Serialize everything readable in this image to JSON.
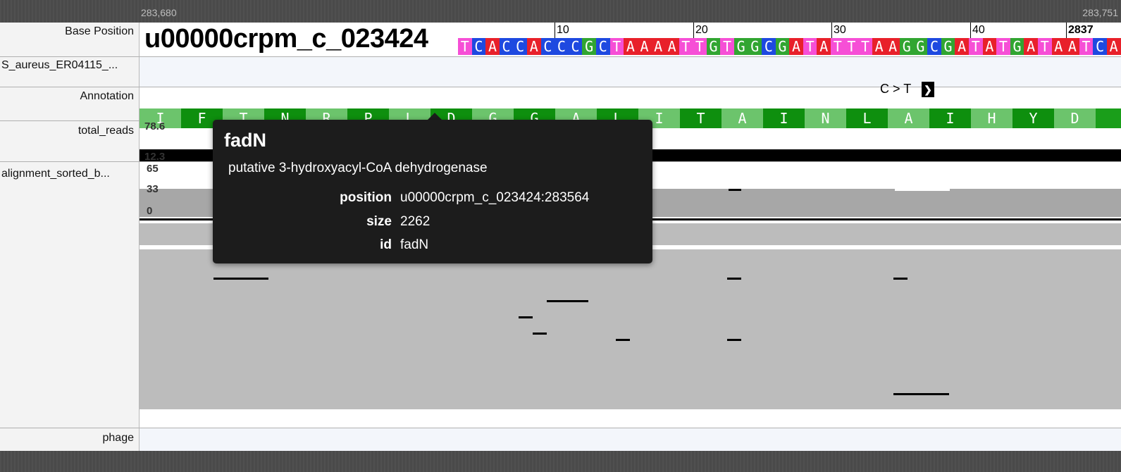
{
  "ruler": {
    "left_coord": "283,680",
    "right_coord": "283,751"
  },
  "labels": {
    "base_position": "Base Position",
    "variant_track": "S_aureus_ER04115_...",
    "annotation": "Annotation",
    "total_reads": "total_reads",
    "alignment": "alignment_sorted_b...",
    "phage": "phage"
  },
  "scaffold_name": "u00000crpm_c_023424",
  "ticks": {
    "t10": "10",
    "t20": "20",
    "t30": "30",
    "t40": "40",
    "t_end": "2837"
  },
  "sequence": "TCACCACCCGCTAAAATTGTGGCGATATTTAAGGCGATATGATAATCA",
  "variant": {
    "label": "C > T",
    "button_icon": "chevron-right-icon"
  },
  "annotation_aa": [
    "I",
    "F",
    "T",
    "N",
    "R",
    "P",
    "L",
    "D",
    "G",
    "G",
    "A",
    "L",
    "I",
    "T",
    "A",
    "I",
    "N",
    "L",
    "A",
    "I",
    "H",
    "Y",
    "D"
  ],
  "total_reads_scale": {
    "max": "78.6",
    "min": "12.3"
  },
  "alignment_axis": {
    "top": "65",
    "mid": "33",
    "bottom": "0"
  },
  "tooltip": {
    "name": "fadN",
    "description": "putative 3-hydroxyacyl-CoA dehydrogenase",
    "position_key": "position",
    "position_val": "u00000crpm_c_023424:283564",
    "size_key": "size",
    "size_val": "2262",
    "id_key": "id",
    "id_val": "fadN"
  },
  "colors": {
    "A": "#e8202a",
    "C": "#1e49e0",
    "G": "#31a531",
    "T": "#f64fd6",
    "annotation": "#1a9e1a"
  }
}
